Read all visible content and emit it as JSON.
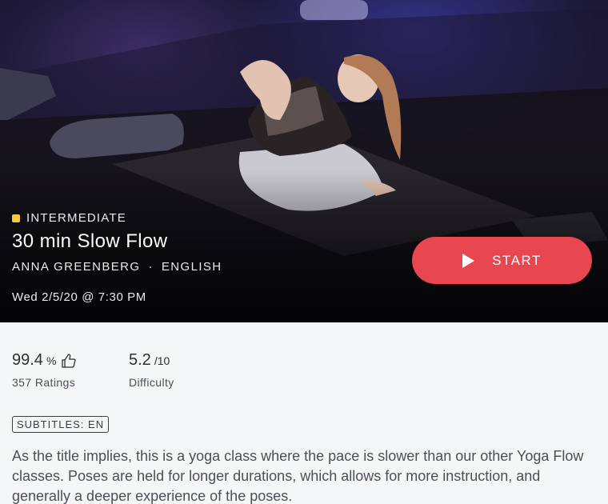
{
  "class": {
    "level": "INTERMEDIATE",
    "title": "30 min Slow Flow",
    "instructor": "ANNA GREENBERG",
    "separator": "·",
    "language": "ENGLISH",
    "air_date": "Wed 2/5/20 @ 7:30 PM"
  },
  "start_button": {
    "label": "START",
    "icon": "play-icon"
  },
  "stats": {
    "rating": {
      "value": "99.4",
      "unit": "%",
      "icon": "thumbs-up-icon",
      "label": "357 Ratings"
    },
    "difficulty": {
      "value": "5.2",
      "unit": "/10",
      "label": "Difficulty"
    }
  },
  "subtitles_badge": "SUBTITLES: EN",
  "description": "As the title implies, this is a yoga class where the pace is slower than our other Yoga Flow classes. Poses are held for longer durations, which allows for more instruction, and generally a deeper experience of the poses.",
  "colors": {
    "accent": "#e8474f",
    "level_dot": "#f5c842"
  }
}
